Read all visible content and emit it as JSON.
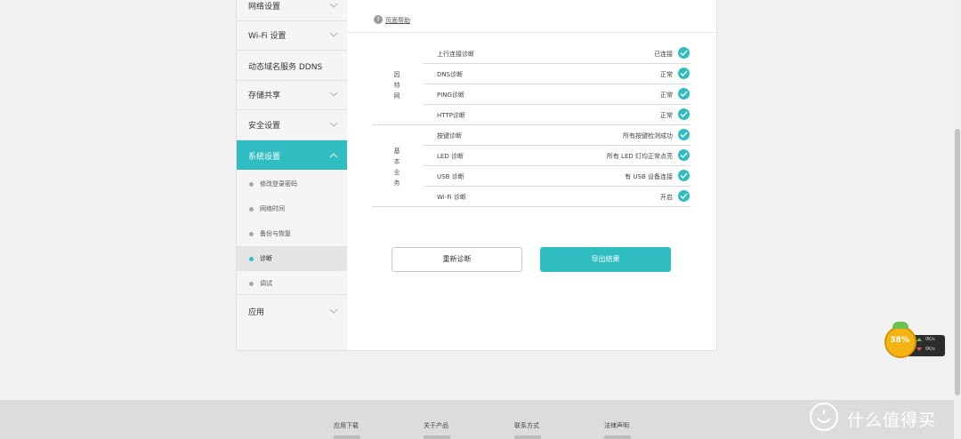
{
  "sidebar": {
    "items": [
      {
        "label": "网络设置"
      },
      {
        "label": "Wi-Fi 设置"
      },
      {
        "label": "动态域名服务 DDNS"
      },
      {
        "label": "存储共享"
      },
      {
        "label": "安全设置"
      },
      {
        "label": "系统设置"
      },
      {
        "label": "应用"
      }
    ],
    "sub_items": [
      {
        "label": "修改登录密码"
      },
      {
        "label": "网络时间"
      },
      {
        "label": "备份与恢复"
      },
      {
        "label": "诊断"
      },
      {
        "label": "调试"
      }
    ],
    "active_item": "系统设置",
    "selected_sub_item": "诊断"
  },
  "main": {
    "help_label": "页面帮助",
    "categories": [
      "因特网",
      "基本业务"
    ],
    "rows": [
      {
        "label": "上行连接诊断",
        "status": "已连接"
      },
      {
        "label": "DNS诊断",
        "status": "正常"
      },
      {
        "label": "PING诊断",
        "status": "正常"
      },
      {
        "label": "HTTP诊断",
        "status": "正常"
      },
      {
        "label": "按键诊断",
        "status": "所有按键检测成功"
      },
      {
        "label": "LED 诊断",
        "status": "所有 LED 灯均正常点亮"
      },
      {
        "label": "USB 诊断",
        "status": "有 USB 设备连接"
      },
      {
        "label": "Wi-Fi 诊断",
        "status": "开启"
      }
    ],
    "rediagnose_button": "重新诊断",
    "export_button": "导出结果"
  },
  "widget": {
    "percent": "38%",
    "upload": "0K/s",
    "download": "0K/s"
  },
  "footer": {
    "links": [
      "应用下载",
      "关于产品",
      "联系方式",
      "法律声明"
    ]
  },
  "watermark": {
    "text": "什么值得买"
  },
  "colors": {
    "accent": "#30bdc2",
    "sidebar_bg": "#f5f5f5",
    "footer_bg": "#dcdcdc"
  }
}
